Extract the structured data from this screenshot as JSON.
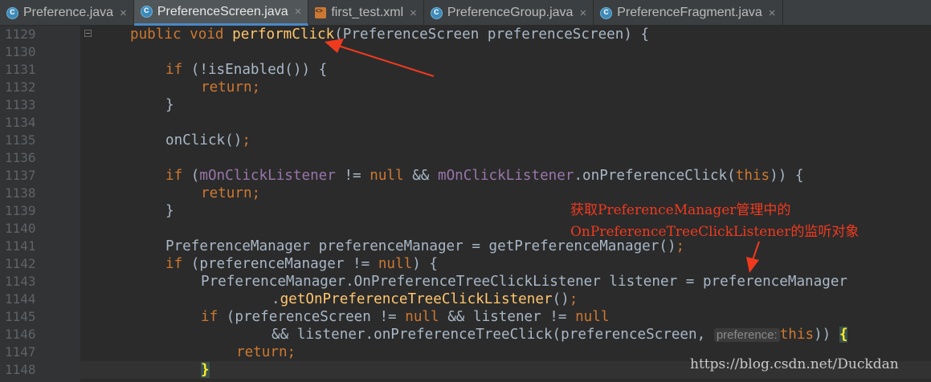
{
  "tabs": [
    {
      "label": "Preference.java",
      "icon": "java-class-icon",
      "active": false
    },
    {
      "label": "PreferenceScreen.java",
      "icon": "java-class-icon",
      "active": true
    },
    {
      "label": "first_test.xml",
      "icon": "xml-file-icon",
      "active": false
    },
    {
      "label": "PreferenceGroup.java",
      "icon": "java-class-icon",
      "active": false
    },
    {
      "label": "PreferenceFragment.java",
      "icon": "java-class-icon",
      "active": false
    }
  ],
  "close_glyph": "×",
  "line_numbers": [
    "1129",
    "1130",
    "1131",
    "1132",
    "1133",
    "1134",
    "1135",
    "1136",
    "1137",
    "1138",
    "1139",
    "1140",
    "1141",
    "1142",
    "1143",
    "1144",
    "1145",
    "1146",
    "1147",
    "1148"
  ],
  "code": {
    "l1129": {
      "a": "public void ",
      "b": "performClick",
      "c": "(PreferenceScreen preferenceScreen) {"
    },
    "l1131": {
      "a": "if ",
      "b": "(!isEnabled()) {"
    },
    "l1132": {
      "a": "return;"
    },
    "l1133": {
      "a": "}"
    },
    "l1135": {
      "a": "onClick()",
      "b": ";"
    },
    "l1137": {
      "a": "if ",
      "b": "(",
      "c": "mOnClickListener",
      "d": " != ",
      "e": "null",
      "f": " && ",
      "g": "mOnClickListener",
      "h": ".onPreferenceClick(",
      "i": "this",
      "j": ")) {"
    },
    "l1138": {
      "a": "return;"
    },
    "l1139": {
      "a": "}"
    },
    "l1141": {
      "a": "PreferenceManager preferenceManager = getPreferenceManager()",
      "b": ";"
    },
    "l1142": {
      "a": "if ",
      "b": "(preferenceManager != ",
      "c": "null",
      "d": ") {"
    },
    "l1143": {
      "a": "PreferenceManager.OnPreferenceTreeClickListener listener = preferenceManager"
    },
    "l1144": {
      "a": ".",
      "b": "getOnPreferenceTreeClickListener",
      "c": "()",
      "d": ";"
    },
    "l1145": {
      "a": "if ",
      "b": "(preferenceScreen != ",
      "c": "null",
      "d": " && listener != ",
      "e": "null"
    },
    "l1146": {
      "a": "&& listener.onPreferenceTreeClick(preferenceScreen, ",
      "hint": "preference:",
      "b": "this",
      "c": ")) ",
      "d": "{"
    },
    "l1147": {
      "a": "return;"
    },
    "l1148": {
      "a": "}"
    }
  },
  "annotation": {
    "line1": "获取PreferenceManager管理中的",
    "line2": "OnPreferenceTreeClickListener的监听对象"
  },
  "watermark": "https://blog.csdn.net/Duckdan",
  "colors": {
    "arrow": "#f03a1f",
    "keyword": "#cc7832",
    "method": "#ffc66d",
    "field": "#9876aa"
  }
}
